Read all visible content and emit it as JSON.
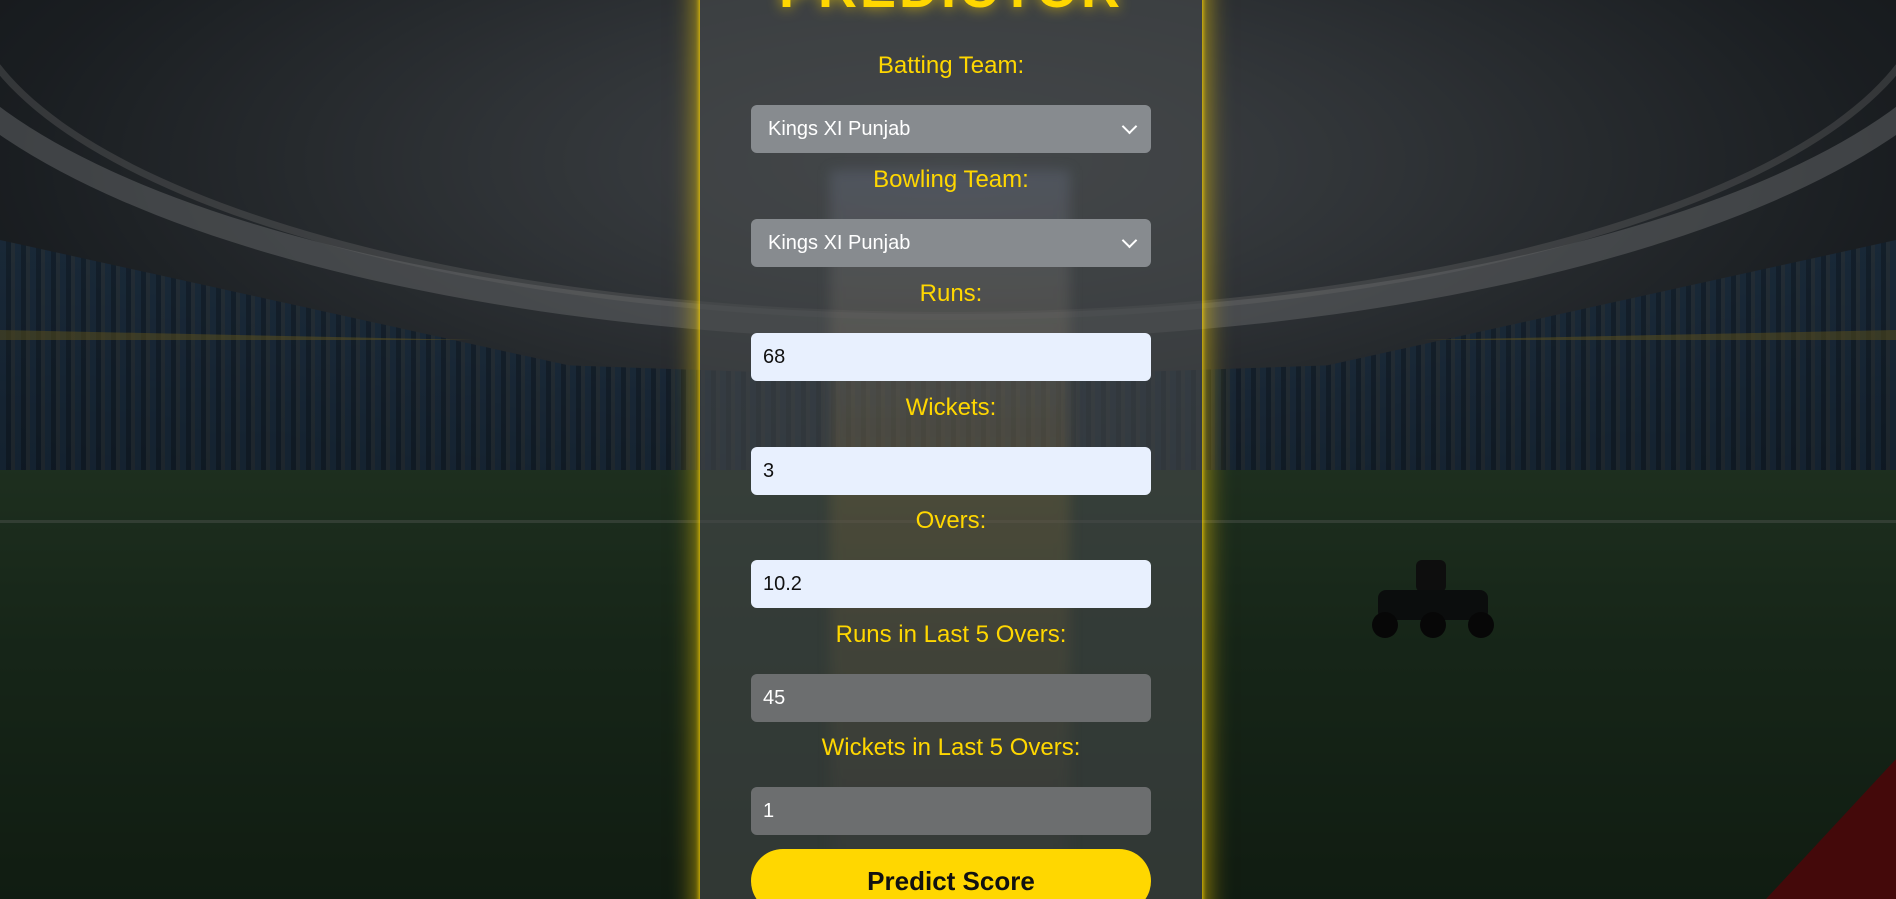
{
  "title": "PREDICTOR",
  "form": {
    "batting_team": {
      "label": "Batting Team:",
      "value": "Kings XI Punjab"
    },
    "bowling_team": {
      "label": "Bowling Team:",
      "value": "Kings XI Punjab"
    },
    "runs": {
      "label": "Runs:",
      "value": "68"
    },
    "wickets": {
      "label": "Wickets:",
      "value": "3"
    },
    "overs": {
      "label": "Overs:",
      "value": "10.2"
    },
    "runs_last5": {
      "label": "Runs in Last 5 Overs:",
      "value": "45"
    },
    "wickets_last5": {
      "label": "Wickets in Last 5 Overs:",
      "value": "1"
    }
  },
  "submit_label": "Predict Score",
  "colors": {
    "accent": "#ffd700",
    "select_bg": "#878b8f",
    "input_light_bg": "#e8f0fe",
    "input_dark_bg": "#6c6e6f"
  },
  "icons": {
    "select_arrow": "chevron-down-icon"
  }
}
